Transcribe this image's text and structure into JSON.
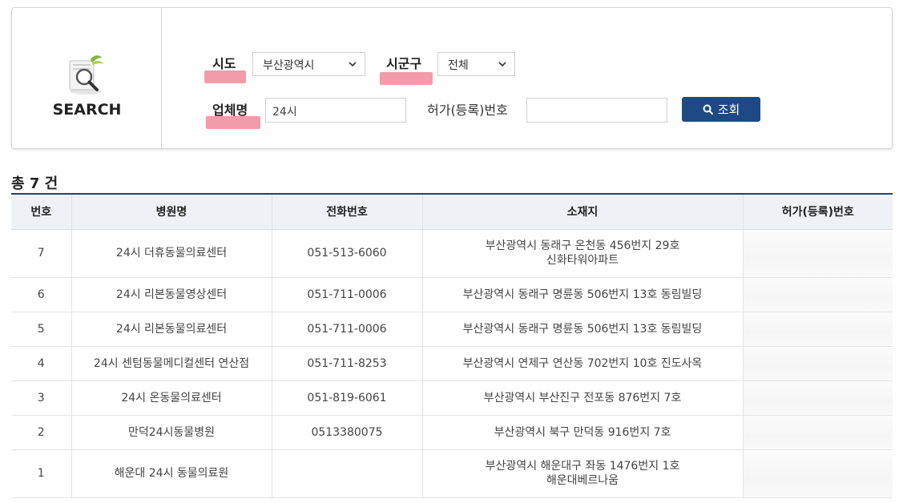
{
  "search": {
    "title": "SEARCH",
    "sido_label": "시도",
    "sido_value": "부산광역시",
    "sigungu_label": "시군구",
    "sigungu_value": "전체",
    "name_label": "업체명",
    "name_value": "24시",
    "permit_label": "허가(등록)번호",
    "permit_value": "",
    "button_label": "조회",
    "highlight_color": "#f08a9c",
    "button_color": "#1d4a84"
  },
  "result": {
    "total_text": "총 7 건"
  },
  "table": {
    "headers": [
      "번호",
      "병원명",
      "전화번호",
      "소재지",
      "허가(등록)번호"
    ],
    "rows": [
      {
        "no": "7",
        "name": "24시 더휴동물의료센터",
        "phone": "051-513-6060",
        "addr1": "부산광역시 동래구 온천동 456번지 29호",
        "addr2": "신화타워아파트",
        "permit": ""
      },
      {
        "no": "6",
        "name": "24시 리본동물영상센터",
        "phone": "051-711-0006",
        "addr1": "부산광역시 동래구 명륜동 506번지 13호 동림빌딩",
        "addr2": "",
        "permit": ""
      },
      {
        "no": "5",
        "name": "24시 리본동물의료센터",
        "phone": "051-711-0006",
        "addr1": "부산광역시 동래구 명륜동 506번지 13호 동림빌딩",
        "addr2": "",
        "permit": ""
      },
      {
        "no": "4",
        "name": "24시 센텀동물메디컬센터 연산점",
        "phone": "051-711-8253",
        "addr1": "부산광역시 연제구 연산동 702번지 10호 진도사옥",
        "addr2": "",
        "permit": ""
      },
      {
        "no": "3",
        "name": "24시 온동물의료센터",
        "phone": "051-819-6061",
        "addr1": "부산광역시 부산진구 전포동 876번지 7호",
        "addr2": "",
        "permit": ""
      },
      {
        "no": "2",
        "name": "만덕24시동물병원",
        "phone": "0513380075",
        "addr1": "부산광역시 북구 만덕동 916번지 7호",
        "addr2": "",
        "permit": ""
      },
      {
        "no": "1",
        "name": "해운대 24시 동물의료원",
        "phone": "",
        "addr1": "부산광역시 해운대구 좌동 1476번지 1호",
        "addr2": "해운대베르나움",
        "permit": ""
      }
    ]
  }
}
